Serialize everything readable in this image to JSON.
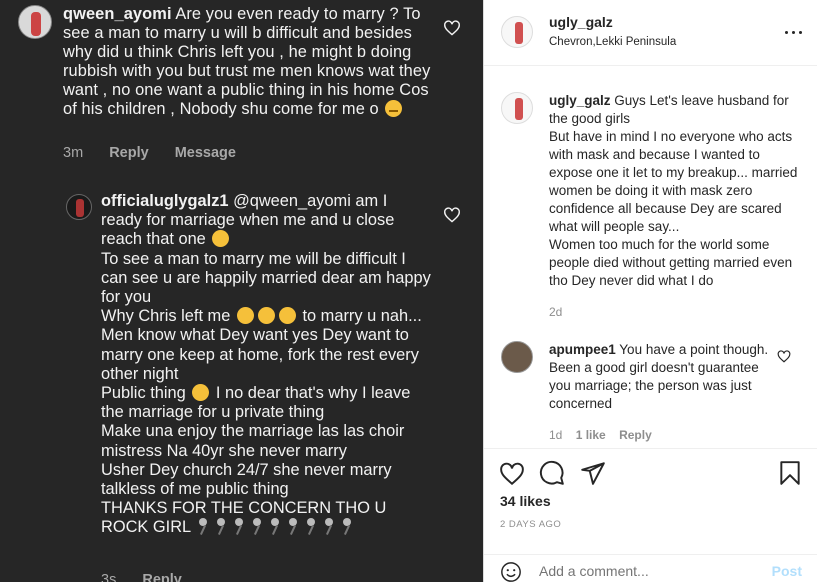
{
  "left": {
    "comment1": {
      "username": "qween_ayomi",
      "text": "Are you even ready to marry ? To see a man to marry u will b difficult and besides why did u think Chris left you , he might b doing rubbish with you but trust me men knows wat they want , no one want a public thing in his home Cos of his children , Nobody shu come for me o",
      "time": "3m",
      "reply": "Reply",
      "message": "Message"
    },
    "comment2": {
      "username": "officialuglygalz1",
      "mention": "@qween_ayomi",
      "line1": "am I ready for marriage when me and u close reach that one",
      "line2": "To see a man to marry me will be difficult I can see u are happily married dear am happy for you",
      "line3a": "Why Chris left me",
      "line3b": "to marry u nah...",
      "line4": "Men know what Dey want yes Dey want to marry one keep at home, fork  the rest every other night",
      "line5a": "Public thing",
      "line5b": "I no dear that's why I leave the marriage for u private thing",
      "line6": "Make una enjoy the marriage las las choir mistress Na 40yr she never marry",
      "line7": "Usher Dey church 24/7 she never marry talkless of me public thing",
      "line8": "THANKS FOR THE CONCERN THO U ROCK GIRL",
      "time": "3s",
      "reply": "Reply"
    }
  },
  "right": {
    "header": {
      "username": "ugly_galz",
      "location": "Chevron,Lekki Peninsula"
    },
    "caption": {
      "username": "ugly_galz",
      "text": "Guys Let's leave husband for the good girls\nBut have in mind I no everyone who acts with mask and because I wanted to expose one it let to my breakup... married women be doing it with mask zero confidence all because Dey are scared what will people say...\nWomen too much for the world some people died without getting married even tho Dey never did what I do",
      "time": "2d"
    },
    "comment": {
      "username": "apumpee1",
      "text": "You have a point though. Been a good girl doesn't guarantee you marriage; the person was just concerned",
      "time": "1d",
      "likes": "1 like",
      "reply": "Reply"
    },
    "likes": "34 likes",
    "date": "2 DAYS AGO",
    "add_comment_placeholder": "Add a comment...",
    "post_label": "Post"
  }
}
